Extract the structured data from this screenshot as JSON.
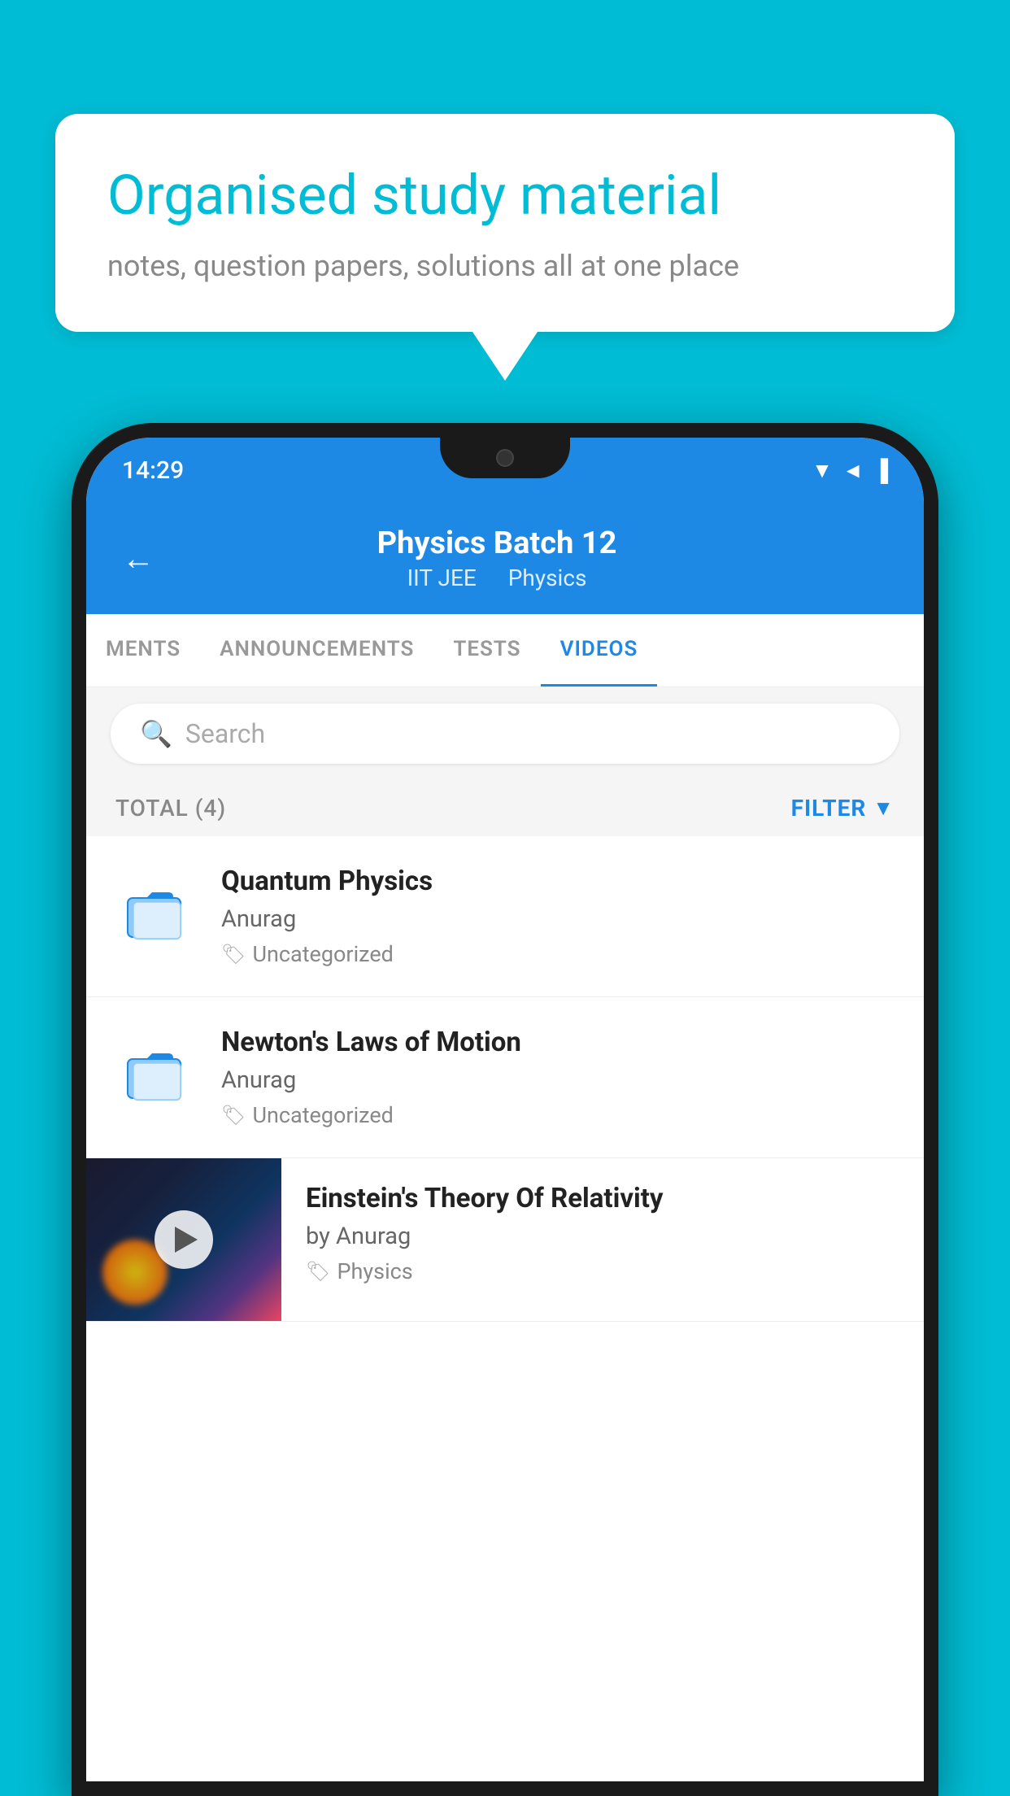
{
  "background": {
    "color": "#00BCD4"
  },
  "speech_bubble": {
    "title": "Organised study material",
    "subtitle": "notes, question papers, solutions all at one place"
  },
  "phone": {
    "status_bar": {
      "time": "14:29",
      "icons": [
        "wifi",
        "signal",
        "battery"
      ]
    },
    "header": {
      "back_label": "←",
      "title": "Physics Batch 12",
      "subtitle_left": "IIT JEE",
      "subtitle_right": "Physics"
    },
    "tabs": [
      {
        "label": "MENTS",
        "active": false
      },
      {
        "label": "ANNOUNCEMENTS",
        "active": false
      },
      {
        "label": "TESTS",
        "active": false
      },
      {
        "label": "VIDEOS",
        "active": true
      }
    ],
    "search": {
      "placeholder": "Search"
    },
    "filter_bar": {
      "total_label": "TOTAL (4)",
      "filter_label": "FILTER"
    },
    "videos": [
      {
        "title": "Quantum Physics",
        "author": "Anurag",
        "tag": "Uncategorized",
        "has_thumbnail": false
      },
      {
        "title": "Newton's Laws of Motion",
        "author": "Anurag",
        "tag": "Uncategorized",
        "has_thumbnail": false
      },
      {
        "title": "Einstein's Theory Of Relativity",
        "author": "by Anurag",
        "tag": "Physics",
        "has_thumbnail": true
      }
    ]
  }
}
